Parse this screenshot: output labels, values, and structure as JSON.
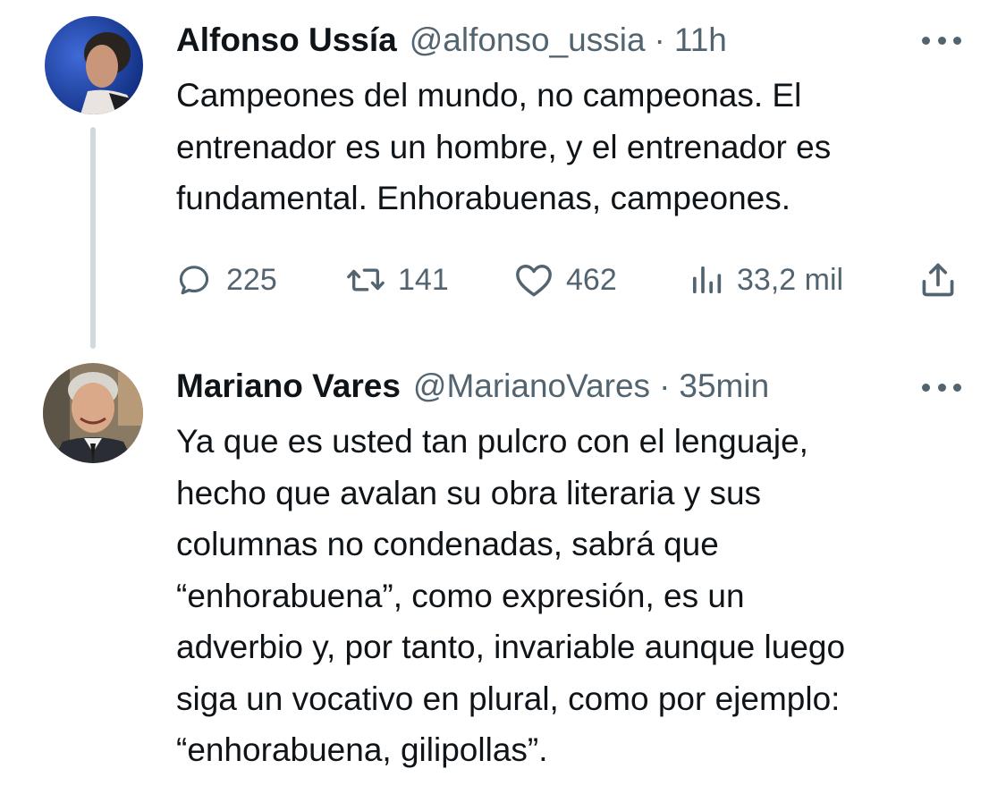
{
  "tweets": [
    {
      "author_name": "Alfonso Ussía",
      "handle": "@alfonso_ussia",
      "separator": "·",
      "time": "11h",
      "text": "Campeones del mundo, no campeonas. El\nentrenador es un hombre, y el entrenador es\nfundamental. Enhorabuenas, campeones.",
      "avatar_icon": "avatar-photo",
      "more_icon": "more-icon",
      "actions": {
        "replies": "225",
        "retweets": "141",
        "likes": "462",
        "views": "33,2 mil"
      }
    },
    {
      "author_name": "Mariano Vares",
      "handle": "@MarianoVares",
      "separator": "·",
      "time": "35min",
      "text": "Ya que es usted tan pulcro con el lenguaje,\nhecho que avalan su obra literaria y sus\ncolumnas no condenadas, sabrá que\n“enhorabuena”, como expresión, es un\nadverbio y, por tanto, invariable aunque luego\nsiga un vocativo en plural, como por ejemplo:\n“enhorabuena, gilipollas”.",
      "avatar_icon": "avatar-photo",
      "more_icon": "more-icon"
    }
  ],
  "colors": {
    "text": "#0f1419",
    "secondary": "#536471",
    "thread_line": "#cfd9de",
    "background": "#ffffff"
  },
  "icons": {
    "reply": "reply-icon",
    "retweet": "retweet-icon",
    "like": "heart-icon",
    "views": "views-icon",
    "share": "share-icon"
  }
}
